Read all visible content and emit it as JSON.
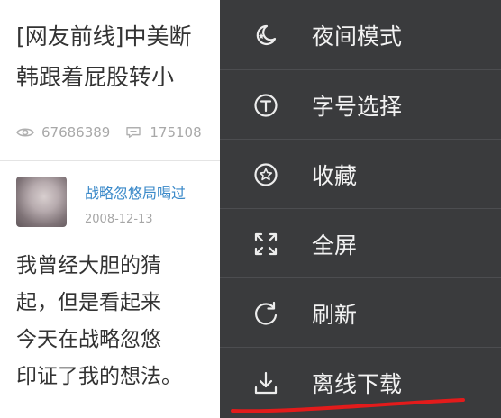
{
  "article": {
    "title_line1": "[网友前线]中美断",
    "title_line2": "韩跟着屁股转小",
    "views": "67686389",
    "comments": "175108"
  },
  "post": {
    "author": "战略忽悠局喝过",
    "date": "2008-12-13",
    "body_lines": [
      "我曾经大胆的猜",
      "起，但是看起来",
      "今天在战略忽悠",
      "印证了我的想法。"
    ]
  },
  "menu": {
    "items": [
      {
        "label": "夜间模式",
        "icon": "night-mode-icon"
      },
      {
        "label": "字号选择",
        "icon": "font-size-icon"
      },
      {
        "label": "收藏",
        "icon": "favorite-star-icon"
      },
      {
        "label": "全屏",
        "icon": "fullscreen-icon"
      },
      {
        "label": "刷新",
        "icon": "refresh-icon"
      },
      {
        "label": "离线下载",
        "icon": "download-icon"
      }
    ]
  },
  "colors": {
    "menu_bg": "#3a3b3d",
    "menu_text": "#f2f2f2",
    "author_link": "#3a89c9",
    "highlight_annotation": "#e31b1b"
  }
}
